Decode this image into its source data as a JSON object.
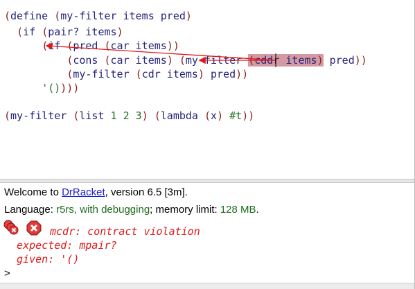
{
  "editor": {
    "lines": [
      [
        {
          "c": "p",
          "t": "("
        },
        {
          "c": "id",
          "t": "define "
        },
        {
          "c": "p",
          "t": "("
        },
        {
          "c": "id",
          "t": "my-filter items pred"
        },
        {
          "c": "p",
          "t": ")"
        }
      ],
      [
        {
          "c": "id",
          "t": "  "
        },
        {
          "c": "p",
          "t": "("
        },
        {
          "c": "id",
          "t": "if "
        },
        {
          "c": "p",
          "t": "("
        },
        {
          "c": "id",
          "t": "pair? items"
        },
        {
          "c": "p",
          "t": ")"
        }
      ],
      [
        {
          "c": "id",
          "t": "      "
        },
        {
          "c": "p",
          "t": "("
        },
        {
          "c": "id",
          "t": "if "
        },
        {
          "c": "p",
          "t": "("
        },
        {
          "c": "id",
          "t": "pred "
        },
        {
          "c": "p",
          "t": "("
        },
        {
          "c": "id",
          "t": "car items"
        },
        {
          "c": "p",
          "t": "))"
        }
      ],
      [
        {
          "c": "id",
          "t": "          "
        },
        {
          "c": "p",
          "t": "("
        },
        {
          "c": "id",
          "t": "cons "
        },
        {
          "c": "p",
          "t": "("
        },
        {
          "c": "id",
          "t": "car items"
        },
        {
          "c": "p",
          "t": ") ("
        },
        {
          "c": "id",
          "t": "my-filter "
        },
        {
          "c": "p hl",
          "t": "("
        },
        {
          "c": "id hl",
          "t": "cddr items"
        },
        {
          "c": "p hl",
          "t": ")"
        },
        {
          "c": "id",
          "t": " pred"
        },
        {
          "c": "p",
          "t": "))"
        }
      ],
      [
        {
          "c": "id",
          "t": "          "
        },
        {
          "c": "p",
          "t": "("
        },
        {
          "c": "id",
          "t": "my-filter "
        },
        {
          "c": "p",
          "t": "("
        },
        {
          "c": "id",
          "t": "cdr items"
        },
        {
          "c": "p",
          "t": ") "
        },
        {
          "c": "id",
          "t": "pred"
        },
        {
          "c": "p",
          "t": "))"
        }
      ],
      [
        {
          "c": "id",
          "t": "      "
        },
        {
          "c": "str",
          "t": "'()"
        },
        {
          "c": "p",
          "t": ")))"
        }
      ],
      [
        {
          "c": "id",
          "t": ""
        }
      ],
      [
        {
          "c": "p",
          "t": "("
        },
        {
          "c": "id",
          "t": "my-filter "
        },
        {
          "c": "p",
          "t": "("
        },
        {
          "c": "id",
          "t": "list "
        },
        {
          "c": "num",
          "t": "1 2 3"
        },
        {
          "c": "p",
          "t": ") ("
        },
        {
          "c": "id",
          "t": "lambda "
        },
        {
          "c": "p",
          "t": "("
        },
        {
          "c": "id",
          "t": "x"
        },
        {
          "c": "p",
          "t": ") "
        },
        {
          "c": "num",
          "t": "#t"
        },
        {
          "c": "p",
          "t": "))"
        }
      ]
    ]
  },
  "repl": {
    "welcome_prefix": "Welcome to ",
    "welcome_link": "DrRacket",
    "welcome_suffix": ", version 6.5 [3m].",
    "lang_prefix": "Language: ",
    "lang_name": "r5rs, with debugging",
    "lang_mid": "; memory limit: ",
    "mem_limit": "128 MB",
    "lang_end": ".",
    "error_line1": "mcdr: contract violation",
    "error_line2": "  expected: mpair?",
    "error_line3": "  given: '()",
    "prompt": ">"
  },
  "colors": {
    "paren": "#8b1c1c",
    "identifier": "#24247a",
    "literal": "#207020",
    "error": "#e01818",
    "highlight": "#d39aa3"
  }
}
